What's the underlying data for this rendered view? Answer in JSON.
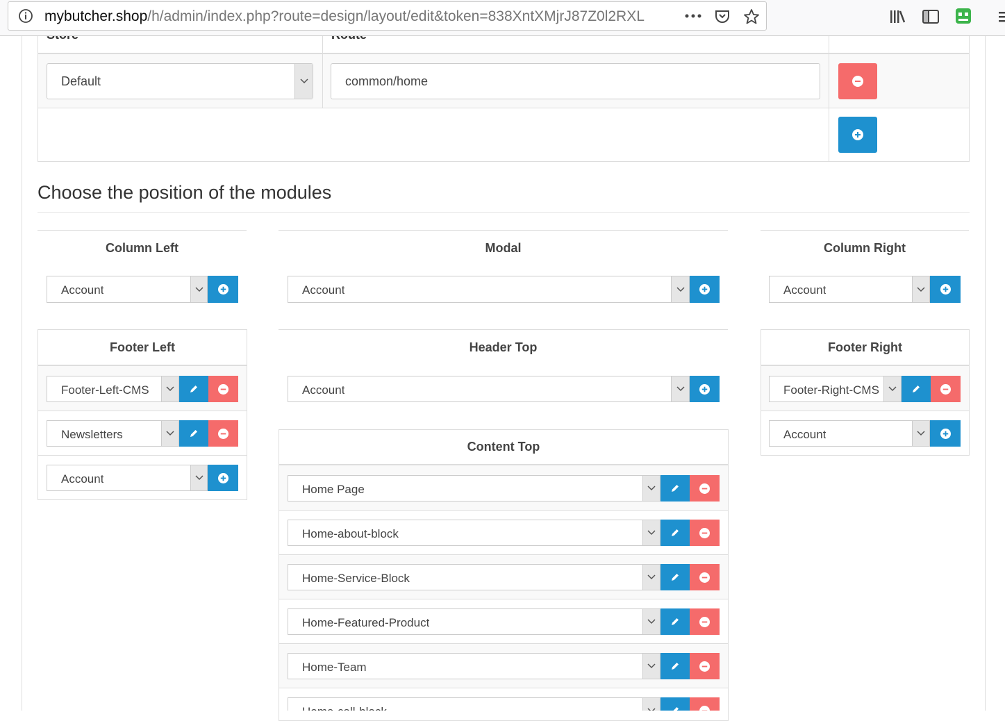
{
  "browser": {
    "url_domain": "mybutcher.shop",
    "url_path": "/h/admin/index.php?route=design/layout/edit&token=838XntXMjrJ87Z0l2RXL"
  },
  "route_table": {
    "col_store": "Store",
    "col_route": "Route",
    "store_value": "Default",
    "route_value": "common/home"
  },
  "section_title": "Choose the position of the modules",
  "positions": {
    "column_left": {
      "title": "Column Left",
      "add_select": "Account"
    },
    "modal": {
      "title": "Modal",
      "add_select": "Account"
    },
    "column_right": {
      "title": "Column Right",
      "add_select": "Account"
    },
    "footer_left": {
      "title": "Footer Left",
      "modules": [
        "Footer-Left-CMS",
        "Newsletters"
      ],
      "add_select": "Account"
    },
    "header_top": {
      "title": "Header Top",
      "add_select": "Account"
    },
    "footer_right": {
      "title": "Footer Right",
      "modules": [
        "Footer-Right-CMS"
      ],
      "add_select": "Account"
    },
    "content_top": {
      "title": "Content Top",
      "modules": [
        "Home Page",
        "Home-about-block",
        "Home-Service-Block",
        "Home-Featured-Product",
        "Home-Team",
        "Home-call-block"
      ]
    }
  },
  "colors": {
    "primary": "#1e91cf",
    "danger": "#f56b6b"
  }
}
